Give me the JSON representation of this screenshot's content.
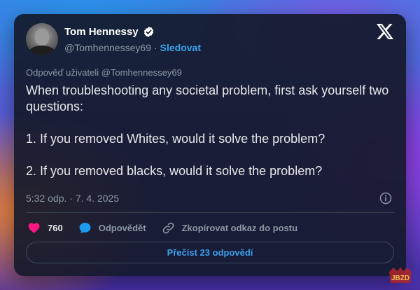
{
  "author": {
    "name": "Tom Hennessy",
    "handle": "@Tomhennessey69",
    "separator": "·",
    "follow_label": "Sledovat"
  },
  "reply_to": "Odpověď uživateli @Tomhennessey69",
  "tweet": {
    "line1": "When troubleshooting any societal problem, first ask yourself two questions:",
    "line2": "1. If you removed Whites, would it solve the problem?",
    "line3": "2. If you removed blacks, would it solve the problem?"
  },
  "timestamp": "5:32 odp. · 7. 4. 2025",
  "actions": {
    "likes": "760",
    "reply_label": "Odpovědět",
    "copy_label": "Zkopírovat odkaz do postu"
  },
  "read_replies_label": "Přečíst 23 odpovědí",
  "watermark": "JBZD",
  "colors": {
    "accent": "#3aa0ec",
    "heart": "#f91880",
    "reply_bubble": "#1d9bf0",
    "card_bg": "#141a2c"
  },
  "icons": [
    "verified-badge-icon",
    "x-logo-icon",
    "info-icon",
    "heart-icon",
    "reply-bubble-icon",
    "link-icon"
  ]
}
